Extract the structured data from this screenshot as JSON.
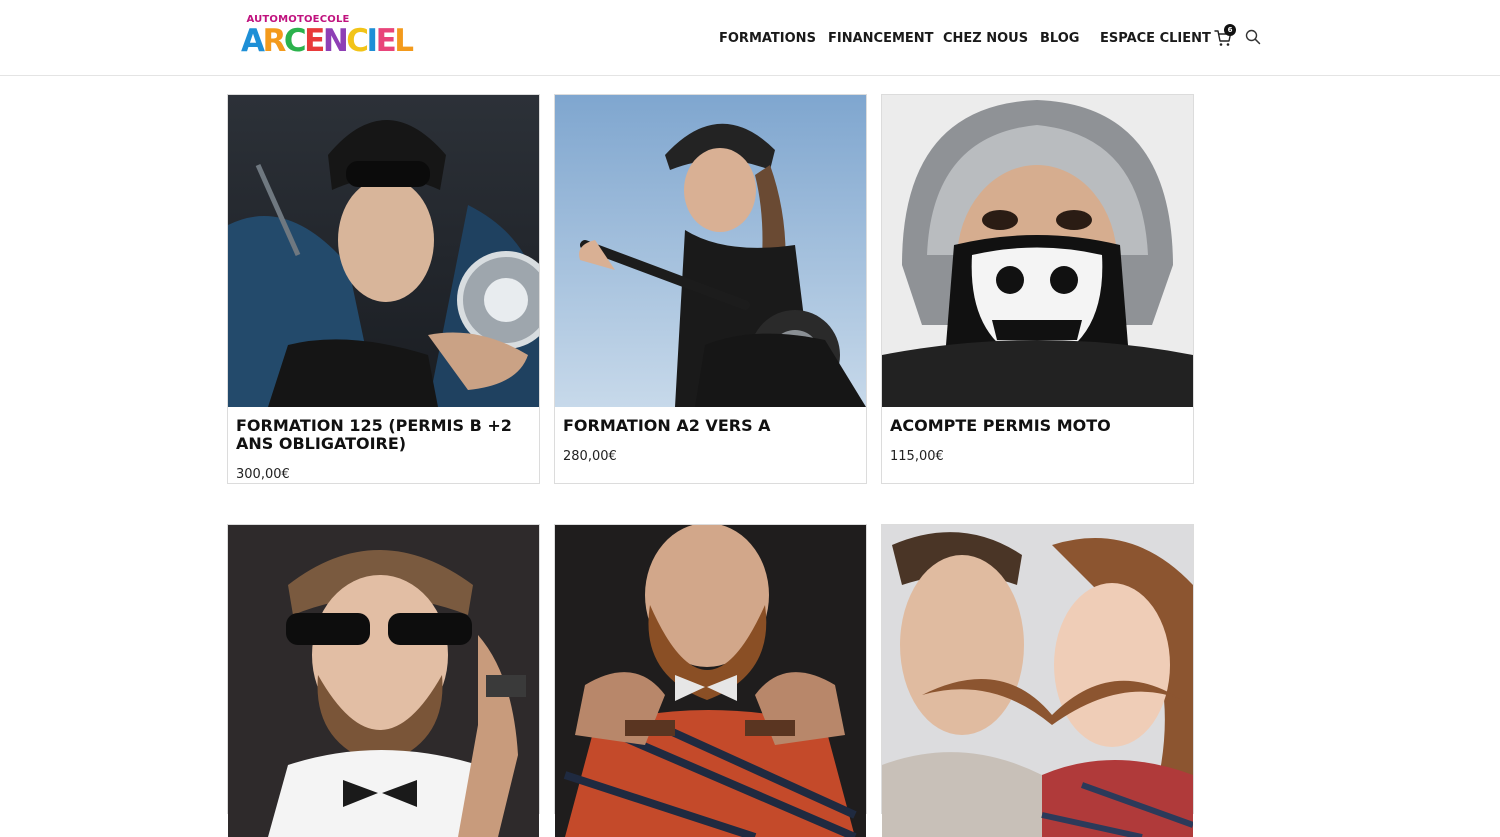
{
  "brand": {
    "logo_top": "AUTOMOTOECOLE",
    "logo_letters": [
      {
        "char": "A",
        "color": "#1e8fd6"
      },
      {
        "char": "R",
        "color": "#f39a1c"
      },
      {
        "char": "C",
        "color": "#2bb24c"
      },
      {
        "char": "E",
        "color": "#e83a3a"
      },
      {
        "char": "N",
        "color": "#8e3fb5"
      },
      {
        "char": "C",
        "color": "#f2c418"
      },
      {
        "char": "I",
        "color": "#1e8fd6"
      },
      {
        "char": "E",
        "color": "#e8447a"
      },
      {
        "char": "L",
        "color": "#f39a1c"
      }
    ]
  },
  "nav": {
    "items": [
      {
        "label": "FORMATIONS"
      },
      {
        "label": "FINANCEMENT"
      },
      {
        "label": "CHEZ NOUS"
      },
      {
        "label": "BLOG"
      },
      {
        "label": "ESPACE CLIENT"
      }
    ],
    "cart_count": "6",
    "cart_icon": "shopping-cart-icon",
    "search_icon": "search-icon"
  },
  "products": [
    {
      "title": "FORMATION 125 (PERMIS B +2 ANS OBLIGATOIRE)",
      "price": "300,00€",
      "image": "motorcyclist-man-helmet-sunglasses"
    },
    {
      "title": "FORMATION A2 VERS A",
      "price": "280,00€",
      "image": "woman-riding-motorcycle"
    },
    {
      "title": "ACOMPTE PERMIS MOTO",
      "price": "115,00€",
      "image": "woman-helmet-skull-mask"
    },
    {
      "image": "bearded-man-sunglasses-bowtie"
    },
    {
      "image": "tattooed-bearded-man-bowtie"
    },
    {
      "image": "couple-hair-mustache"
    }
  ],
  "colors": {
    "nav_text": "#1a1a1a",
    "card_border": "#dcdcdc",
    "header_border": "#e4e4e4"
  }
}
